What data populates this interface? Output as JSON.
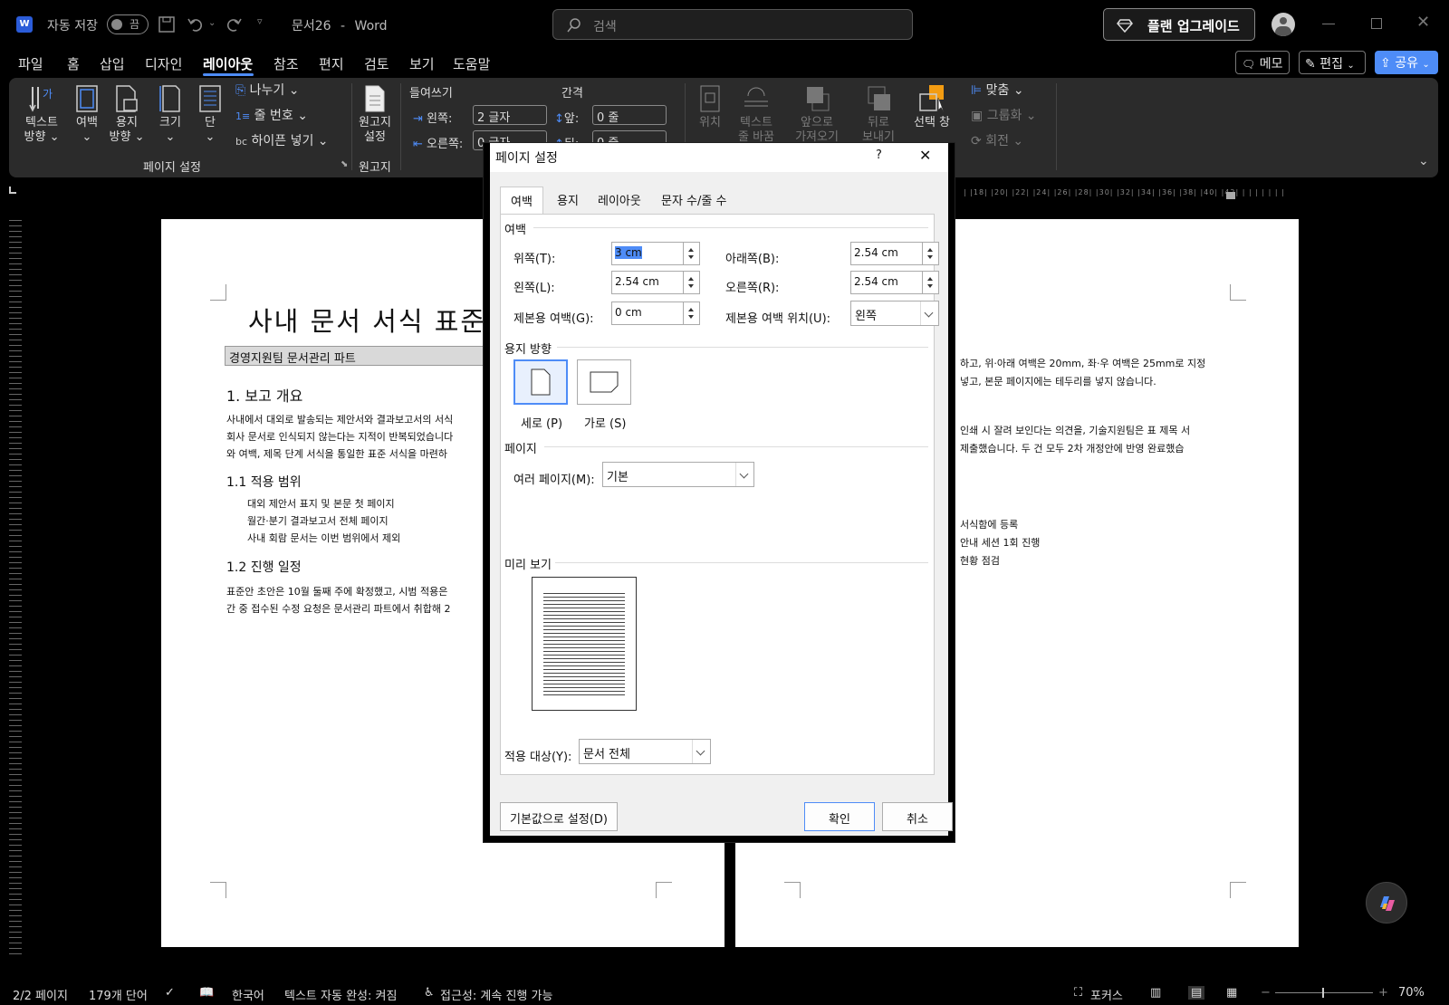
{
  "titlebar": {
    "autosave_label": "자동 저장",
    "autosave_state": "끔",
    "doc_title": "문서26",
    "app_name": "Word",
    "separator": "-",
    "search_placeholder": "검색",
    "upgrade_label": "플랜 업그레이드"
  },
  "menu": {
    "tabs": [
      "파일",
      "홈",
      "삽입",
      "디자인",
      "레이아웃",
      "참조",
      "편지",
      "검토",
      "보기",
      "도움말"
    ],
    "active": "레이아웃",
    "memo_label": "메모",
    "edit_label": "편집",
    "share_label": "공유"
  },
  "ribbon": {
    "text_dir": [
      "텍스트",
      "방향"
    ],
    "margins": "여백",
    "orientation": [
      "용지",
      "방향"
    ],
    "size": "크기",
    "columns": "단",
    "breaks": "나누기",
    "line_numbers": "줄 번호",
    "hyphenation": "하이픈 넣기",
    "group_page_setup": "페이지 설정",
    "manuscript": [
      "원고지",
      "설정"
    ],
    "group_manuscript": "원고지",
    "indent_label": "들여쓰기",
    "spacing_label": "간격",
    "left_label": "왼쪽:",
    "left_value": "2 글자",
    "right_label": "오른쪽:",
    "right_value": "0 글자",
    "before_label": "앞:",
    "before_value": "0 줄",
    "after_label": "뒤:",
    "after_value": "0 줄",
    "position": "위치",
    "wrap_text": [
      "텍스트",
      "줄 바꿈"
    ],
    "bring_forward": [
      "앞으로",
      "가져오기"
    ],
    "send_backward": [
      "뒤로",
      "보내기"
    ],
    "selection_pane": "선택 창",
    "align": "맞춤",
    "group": "그룹화",
    "rotate": "회전"
  },
  "document": {
    "title": "사내 문서 서식 표준",
    "subtitle_box": "경영지원팀 문서관리 파트",
    "h1": "1. 보고 개요",
    "p1": [
      "사내에서 대외로 발송되는 제안서와 결과보고서의 서식",
      "회사 문서로 인식되지 않는다는 지적이 반복되었습니다",
      "와 여백, 제목 단계 서식을 통일한 표준 서식을 마련하"
    ],
    "h11": "1.1 적용 범위",
    "list1": [
      "대외 제안서 표지 및 본문 첫 페이지",
      "월간·분기 결과보고서 전체 페이지",
      "사내 회람 문서는 이번 범위에서 제외"
    ],
    "h12": "1.2 진행 일정",
    "p2": [
      "표준안 초안은 10월 둘째 주에 확정했고, 시범 적용은",
      "간 중 접수된 수정 요청은 문서관리 파트에서 취합해 2"
    ],
    "right_p1": [
      "하고, 위·아래 여백은 20mm, 좌·우 여백은 25mm로 지정",
      "넣고, 본문 페이지에는 테두리를 넣지 않습니다."
    ],
    "right_p2": [
      "인쇄 시 잘려 보인다는 의견을, 기술지원팀은 표 제목 서",
      "제출했습니다. 두 건 모두 2차 개정안에 반영 완료했습"
    ],
    "right_list": [
      "서식함에 등록",
      "안내 세션 1회 진행",
      "현황 점검"
    ]
  },
  "dialog": {
    "title": "페이지 설정",
    "help": "?",
    "tabs": [
      "여백",
      "용지",
      "레이아웃",
      "문자 수/줄 수"
    ],
    "active_tab": "여백",
    "sec_margins": "여백",
    "top_label": "위쪽(T):",
    "top_value": "3 cm",
    "bottom_label": "아래쪽(B):",
    "bottom_value": "2.54 cm",
    "left_label": "왼쪽(L):",
    "left_value": "2.54 cm",
    "right_label": "오른쪽(R):",
    "right_value": "2.54 cm",
    "gutter_label": "제본용 여백(G):",
    "gutter_value": "0 cm",
    "gutter_pos_label": "제본용 여백 위치(U):",
    "gutter_pos_value": "왼쪽",
    "sec_orientation": "용지 방향",
    "portrait": "세로 (P)",
    "landscape": "가로 (S)",
    "sec_pages": "페이지",
    "multi_label": "여러 페이지(M):",
    "multi_value": "기본",
    "sec_preview": "미리 보기",
    "apply_label": "적용 대상(Y):",
    "apply_value": "문서 전체",
    "default_btn": "기본값으로 설정(D)",
    "ok_btn": "확인",
    "cancel_btn": "취소"
  },
  "statusbar": {
    "page": "2/2 페이지",
    "words": "179개 단어",
    "language": "한국어",
    "autocomplete": "텍스트 자동 완성: 켜짐",
    "accessibility": "접근성: 계속 진행 가능",
    "focus": "포커스",
    "zoom": "70%"
  },
  "colors": {
    "accent": "#4e8cf7",
    "ribbon_bg": "#2b2b2b",
    "dialog_bg": "#f0f0f0",
    "selection_orange": "#f39c12"
  }
}
